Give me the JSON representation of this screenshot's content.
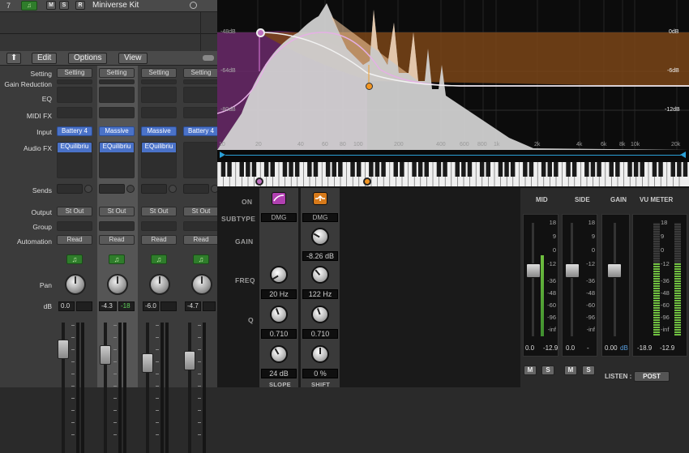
{
  "track": {
    "number": "7",
    "m": "M",
    "s": "S",
    "r": "R",
    "name": "Miniverse Kit"
  },
  "toolbar": {
    "edit": "Edit",
    "options": "Options",
    "view": "View"
  },
  "row_labels": {
    "setting": "Setting",
    "gain_reduction": "Gain Reduction",
    "eq": "EQ",
    "midi_fx": "MIDI FX",
    "input": "Input",
    "audio_fx": "Audio FX",
    "sends": "Sends",
    "output": "Output",
    "group": "Group",
    "automation": "Automation",
    "pan": "Pan",
    "db": "dB"
  },
  "strips": [
    {
      "setting": "Setting",
      "input": "Battery 4",
      "audio_fx": "EQuilibriu",
      "output": "St Out",
      "automation": "Read",
      "db": "0.0",
      "peak": ""
    },
    {
      "setting": "Setting",
      "input": "Massive",
      "audio_fx": "EQuilibriu",
      "output": "St Out",
      "automation": "Read",
      "db": "-4.3",
      "peak": "-18"
    },
    {
      "setting": "Setting",
      "input": "Massive",
      "audio_fx": "EQuilibriu",
      "output": "St Out",
      "automation": "Read",
      "db": "-6.0",
      "peak": ""
    },
    {
      "setting": "Setting",
      "input": "Battery 4",
      "audio_fx": "",
      "output": "St Out",
      "automation": "Read",
      "db": "-4.7",
      "peak": ""
    }
  ],
  "eq": {
    "db_left": [
      "-48dB",
      "-64dB",
      "-80dB"
    ],
    "db_right": [
      "0dB",
      "-6dB",
      "-12dB"
    ],
    "freq_labels": [
      "10",
      "20",
      "40",
      "60",
      "80",
      "100",
      "200",
      "400",
      "600",
      "800",
      "1k",
      "2k",
      "4k",
      "6k",
      "8k",
      "10k",
      "20k"
    ]
  },
  "bands": {
    "labels": {
      "on": "ON",
      "subtype": "SUBTYPE",
      "gain": "GAIN",
      "freq": "FREQ",
      "q": "Q"
    },
    "band1": {
      "subtype": "DMG",
      "freq": "20 Hz",
      "q": "0.710",
      "slope": "24 dB",
      "footer": "SLOPE"
    },
    "band2": {
      "subtype": "DMG",
      "gain": "-8.26 dB",
      "freq": "122 Hz",
      "q": "0.710",
      "shift": "0 %",
      "footer": "SHIFT"
    }
  },
  "meters": {
    "mid": "MID",
    "side": "SIDE",
    "gain": "GAIN",
    "vu": "VU METER",
    "scale_ms": [
      "18",
      "9",
      "0",
      "-12",
      "-36",
      "-48",
      "-60",
      "-96",
      "-inf"
    ],
    "scale_vu": [
      "18",
      "9",
      "0",
      "-12",
      "-36",
      "-48",
      "-60",
      "-96",
      "-inf"
    ],
    "mid_vals": [
      "0.0",
      "-12.9"
    ],
    "side_vals": [
      "0.0",
      "-"
    ],
    "gain_vals": [
      "0.00",
      "dB"
    ],
    "vu_vals": [
      "-18.9",
      "-12.9"
    ],
    "m": "M",
    "s": "S",
    "listen": "LISTEN :",
    "post": "POST"
  }
}
